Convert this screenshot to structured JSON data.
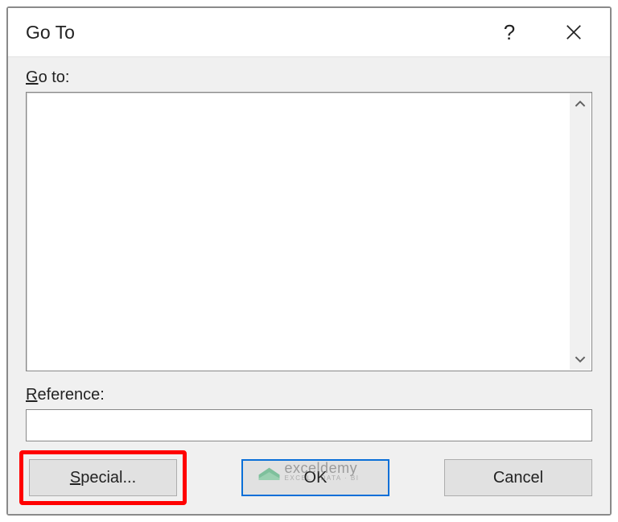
{
  "dialog": {
    "title": "Go To",
    "help_tooltip": "?",
    "goto_label_html": "Go to:",
    "goto_underline": "G",
    "goto_rest": "o to:",
    "reference_underline": "R",
    "reference_rest": "eference:",
    "reference_value": "",
    "buttons": {
      "special_underline": "S",
      "special_rest": "pecial...",
      "ok": "OK",
      "cancel": "Cancel"
    }
  },
  "watermark": {
    "main": "exceldemy",
    "sub": "EXCEL · DATA · BI"
  }
}
